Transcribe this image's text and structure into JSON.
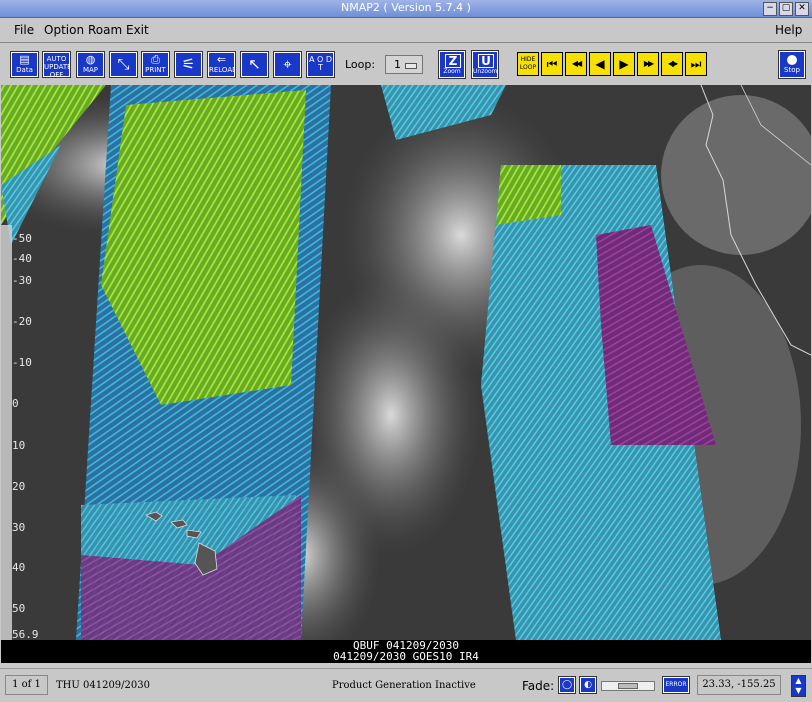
{
  "window": {
    "title": "NMAP2 ( Version 5.7.4 )",
    "controls": [
      "−",
      "▢",
      "✕"
    ]
  },
  "menu": {
    "file": "File",
    "option": "Option",
    "roam": "Roam",
    "exit": "Exit",
    "help": "Help"
  },
  "toolbar": {
    "buttons": [
      {
        "name": "data-button",
        "label": "Data",
        "glyph": "▤"
      },
      {
        "name": "auto-update-button",
        "label": "AUTO UPDATE OFF",
        "glyph": ""
      },
      {
        "name": "map-button",
        "label": "MAP",
        "glyph": "◍"
      },
      {
        "name": "projection-button",
        "label": "",
        "glyph": "⤡"
      },
      {
        "name": "print-button",
        "label": "PRINT",
        "glyph": "⎙"
      },
      {
        "name": "clear-button",
        "label": "",
        "glyph": "⚟"
      },
      {
        "name": "reload-button",
        "label": "RELOAD",
        "glyph": "⇐"
      },
      {
        "name": "roam-button",
        "label": "",
        "glyph": "↖"
      },
      {
        "name": "cursor-button",
        "label": "",
        "glyph": "⌖"
      },
      {
        "name": "text-button",
        "label": "A O D T",
        "glyph": ""
      }
    ],
    "loop_label": "Loop:",
    "loop_value": "1",
    "zoom_label": "Zoom",
    "unzoom_label": "Unzoom",
    "playback": [
      {
        "name": "hide-loop-button",
        "glyph": "HIDE LOOP"
      },
      {
        "name": "first-frame-button",
        "glyph": "⏮"
      },
      {
        "name": "fast-back-button",
        "glyph": "◀◀"
      },
      {
        "name": "step-back-button",
        "glyph": "◀"
      },
      {
        "name": "step-forward-button",
        "glyph": "▶"
      },
      {
        "name": "fast-forward-button",
        "glyph": "▶▶"
      },
      {
        "name": "rock-button",
        "glyph": "◀▶"
      },
      {
        "name": "last-frame-button",
        "glyph": "⏭"
      }
    ],
    "stop_label": "Stop"
  },
  "map": {
    "latitude_labels": [
      "-50",
      "-40",
      "-30",
      "-20",
      "-10",
      "0",
      "10",
      "20",
      "30",
      "40",
      "50",
      "56.9"
    ],
    "caption_line1": "QBUF 041209/2030",
    "caption_line2": "041209/2030 GOES10  IR4"
  },
  "status": {
    "frame": "1 of 1",
    "time": "THU 041209/2030",
    "message": "Product Generation Inactive",
    "fade_label": "Fade:",
    "error_label": "ERROR",
    "coords": "23.33, -155.25"
  }
}
